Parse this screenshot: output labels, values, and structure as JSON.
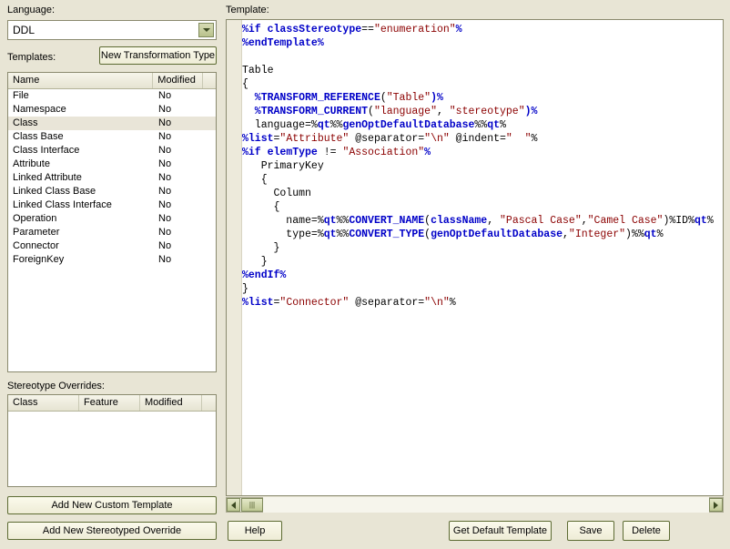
{
  "left": {
    "language_label": "Language:",
    "language_value": "DDL",
    "templates_label": "Templates:",
    "new_transformation_button": "New Transformation Type",
    "templates_columns": [
      "Name",
      "Modified",
      ""
    ],
    "templates_rows": [
      {
        "name": "File",
        "modified": "No",
        "selected": false
      },
      {
        "name": "Namespace",
        "modified": "No",
        "selected": false
      },
      {
        "name": "Class",
        "modified": "No",
        "selected": true
      },
      {
        "name": "Class Base",
        "modified": "No",
        "selected": false
      },
      {
        "name": "Class Interface",
        "modified": "No",
        "selected": false
      },
      {
        "name": "Attribute",
        "modified": "No",
        "selected": false
      },
      {
        "name": "Linked Attribute",
        "modified": "No",
        "selected": false
      },
      {
        "name": "Linked Class Base",
        "modified": "No",
        "selected": false
      },
      {
        "name": "Linked Class Interface",
        "modified": "No",
        "selected": false
      },
      {
        "name": "Operation",
        "modified": "No",
        "selected": false
      },
      {
        "name": "Parameter",
        "modified": "No",
        "selected": false
      },
      {
        "name": "Connector",
        "modified": "No",
        "selected": false
      },
      {
        "name": "ForeignKey",
        "modified": "No",
        "selected": false
      }
    ],
    "overrides_label": "Stereotype Overrides:",
    "overrides_columns": [
      "Class",
      "Feature",
      "Modified",
      ""
    ],
    "overrides_rows": [],
    "add_custom_template_button": "Add New Custom Template",
    "add_stereotyped_override_button": "Add New Stereotyped Override"
  },
  "right": {
    "template_label": "Template:",
    "code_lines": [
      [
        {
          "t": "%if ",
          "c": "k"
        },
        {
          "t": "classStereotype",
          "c": "k"
        },
        {
          "t": "==",
          "c": "p"
        },
        {
          "t": "\"enumeration\"",
          "c": "s"
        },
        {
          "t": "%",
          "c": "k"
        }
      ],
      [
        {
          "t": "%endTemplate%",
          "c": "k"
        }
      ],
      [],
      [
        {
          "t": "Table",
          "c": "p"
        }
      ],
      [
        {
          "t": "{",
          "c": "p"
        }
      ],
      [
        {
          "t": "  %",
          "c": "k"
        },
        {
          "t": "TRANSFORM_REFERENCE",
          "c": "f"
        },
        {
          "t": "(",
          "c": "p"
        },
        {
          "t": "\"Table\"",
          "c": "s"
        },
        {
          "t": ")%",
          "c": "k"
        }
      ],
      [
        {
          "t": "  %",
          "c": "k"
        },
        {
          "t": "TRANSFORM_CURRENT",
          "c": "f"
        },
        {
          "t": "(",
          "c": "p"
        },
        {
          "t": "\"language\"",
          "c": "s"
        },
        {
          "t": ", ",
          "c": "p"
        },
        {
          "t": "\"stereotype\"",
          "c": "s"
        },
        {
          "t": ")%",
          "c": "k"
        }
      ],
      [
        {
          "t": "  language=%",
          "c": "p"
        },
        {
          "t": "qt",
          "c": "k"
        },
        {
          "t": "%%",
          "c": "p"
        },
        {
          "t": "genOptDefaultDatabase",
          "c": "k"
        },
        {
          "t": "%%",
          "c": "p"
        },
        {
          "t": "qt",
          "c": "k"
        },
        {
          "t": "%",
          "c": "p"
        }
      ],
      [
        {
          "t": "%",
          "c": "k"
        },
        {
          "t": "list",
          "c": "k"
        },
        {
          "t": "=",
          "c": "p"
        },
        {
          "t": "\"Attribute\"",
          "c": "s"
        },
        {
          "t": " @separator=",
          "c": "p"
        },
        {
          "t": "\"\\n\"",
          "c": "s"
        },
        {
          "t": " @indent=",
          "c": "p"
        },
        {
          "t": "\"  \"",
          "c": "s"
        },
        {
          "t": "%",
          "c": "p"
        }
      ],
      [
        {
          "t": "%if ",
          "c": "k"
        },
        {
          "t": "elemType",
          "c": "k"
        },
        {
          "t": " != ",
          "c": "p"
        },
        {
          "t": "\"Association\"",
          "c": "s"
        },
        {
          "t": "%",
          "c": "k"
        }
      ],
      [
        {
          "t": "   PrimaryKey",
          "c": "p"
        }
      ],
      [
        {
          "t": "   {",
          "c": "p"
        }
      ],
      [
        {
          "t": "     Column",
          "c": "p"
        }
      ],
      [
        {
          "t": "     {",
          "c": "p"
        }
      ],
      [
        {
          "t": "       name=%",
          "c": "p"
        },
        {
          "t": "qt",
          "c": "k"
        },
        {
          "t": "%%",
          "c": "p"
        },
        {
          "t": "CONVERT_NAME",
          "c": "f"
        },
        {
          "t": "(",
          "c": "p"
        },
        {
          "t": "className",
          "c": "k"
        },
        {
          "t": ", ",
          "c": "p"
        },
        {
          "t": "\"Pascal Case\"",
          "c": "s"
        },
        {
          "t": ",",
          "c": "p"
        },
        {
          "t": "\"Camel Case\"",
          "c": "s"
        },
        {
          "t": ")%",
          "c": "p"
        },
        {
          "t": "ID",
          "c": "p"
        },
        {
          "t": "%",
          "c": "p"
        },
        {
          "t": "qt",
          "c": "k"
        },
        {
          "t": "%",
          "c": "p"
        }
      ],
      [
        {
          "t": "       type=%",
          "c": "p"
        },
        {
          "t": "qt",
          "c": "k"
        },
        {
          "t": "%%",
          "c": "p"
        },
        {
          "t": "CONVERT_TYPE",
          "c": "f"
        },
        {
          "t": "(",
          "c": "p"
        },
        {
          "t": "genOptDefaultDatabase",
          "c": "k"
        },
        {
          "t": ",",
          "c": "p"
        },
        {
          "t": "\"Integer\"",
          "c": "s"
        },
        {
          "t": ")%%",
          "c": "p"
        },
        {
          "t": "qt",
          "c": "k"
        },
        {
          "t": "%",
          "c": "p"
        }
      ],
      [
        {
          "t": "     }",
          "c": "p"
        }
      ],
      [
        {
          "t": "   }",
          "c": "p"
        }
      ],
      [
        {
          "t": "%endIf%",
          "c": "k"
        }
      ],
      [
        {
          "t": "}",
          "c": "p"
        }
      ],
      [
        {
          "t": "%",
          "c": "k"
        },
        {
          "t": "list",
          "c": "k"
        },
        {
          "t": "=",
          "c": "p"
        },
        {
          "t": "\"Connector\"",
          "c": "s"
        },
        {
          "t": " @separator=",
          "c": "p"
        },
        {
          "t": "\"\\n\"",
          "c": "s"
        },
        {
          "t": "%",
          "c": "p"
        }
      ]
    ],
    "scrollbar": {
      "left_arrow": "left-arrow",
      "right_arrow": "right-arrow",
      "thumb": "thumb"
    },
    "help_button": "Help",
    "get_default_template_button": "Get Default Template",
    "save_button": "Save",
    "delete_button": "Delete"
  },
  "colors": {
    "dialog_bg": "#e8e5d5",
    "keyword": "#0000c8",
    "string": "#8b0000",
    "plain": "#000000",
    "selection": "#e9e5d8",
    "border": "#8a8a6e",
    "button_border": "#5d6b33"
  }
}
